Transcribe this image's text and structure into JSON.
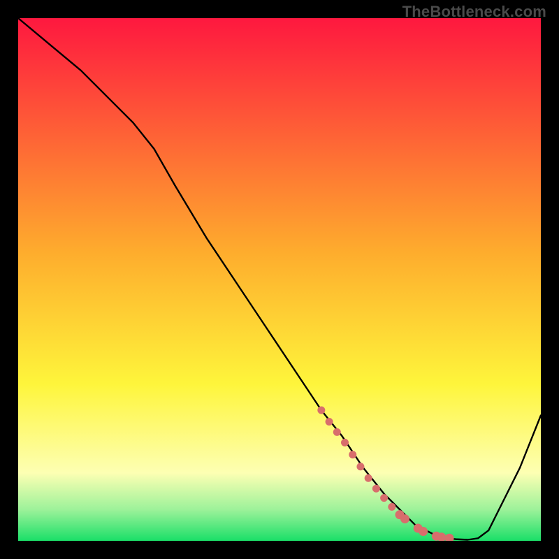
{
  "watermark": "TheBottleneck.com",
  "colors": {
    "bg": "#000000",
    "curve": "#000000",
    "marker_fill": "#d86e6c",
    "marker_stroke": "#d86e6c",
    "grad_top": "#fe183f",
    "grad_mid_upper": "#fead2d",
    "grad_mid_lower": "#fef53b",
    "grad_pale": "#fdffb3",
    "grad_green_light": "#9df29a",
    "grad_green": "#1adf68"
  },
  "chart_data": {
    "type": "line",
    "title": "",
    "xlabel": "",
    "ylabel": "",
    "xlim": [
      0,
      100
    ],
    "ylim": [
      0,
      100
    ],
    "x": [
      0,
      6,
      12,
      18,
      22,
      26,
      30,
      36,
      42,
      48,
      54,
      58,
      62,
      66,
      70,
      72,
      74,
      76,
      78,
      80,
      82,
      84,
      86,
      88,
      90,
      92,
      96,
      100
    ],
    "y": [
      100,
      95,
      90,
      84,
      80,
      75,
      68,
      58,
      49,
      40,
      31,
      25,
      20,
      14,
      9,
      7,
      5,
      3,
      2,
      1,
      0.5,
      0.3,
      0.2,
      0.5,
      2,
      6,
      14,
      24
    ],
    "markers": {
      "comment": "dotted/emphasized segment near the valley",
      "points": [
        {
          "x": 58.0,
          "y": 25.0,
          "r": 5
        },
        {
          "x": 59.5,
          "y": 22.8,
          "r": 5
        },
        {
          "x": 61.0,
          "y": 20.8,
          "r": 5
        },
        {
          "x": 62.5,
          "y": 18.8,
          "r": 5
        },
        {
          "x": 64.0,
          "y": 16.5,
          "r": 5
        },
        {
          "x": 65.5,
          "y": 14.2,
          "r": 5
        },
        {
          "x": 67.0,
          "y": 12.0,
          "r": 5
        },
        {
          "x": 68.5,
          "y": 10.0,
          "r": 5
        },
        {
          "x": 70.0,
          "y": 8.2,
          "r": 5
        },
        {
          "x": 71.5,
          "y": 6.5,
          "r": 5
        },
        {
          "x": 73.0,
          "y": 5.0,
          "r": 6
        },
        {
          "x": 74.0,
          "y": 4.2,
          "r": 6
        },
        {
          "x": 76.5,
          "y": 2.4,
          "r": 6
        },
        {
          "x": 77.5,
          "y": 1.8,
          "r": 6
        },
        {
          "x": 80.0,
          "y": 0.9,
          "r": 6
        },
        {
          "x": 81.0,
          "y": 0.7,
          "r": 6
        },
        {
          "x": 82.5,
          "y": 0.5,
          "r": 6
        }
      ]
    }
  }
}
